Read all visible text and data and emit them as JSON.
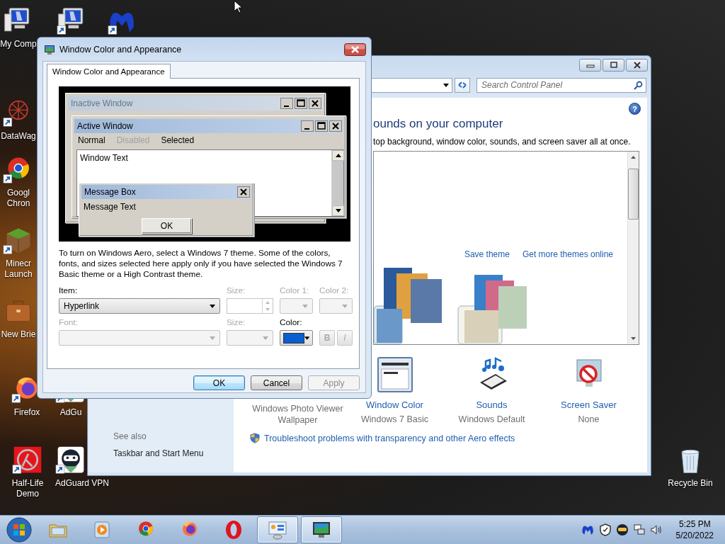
{
  "desktop_icons": [
    {
      "kind": "computer",
      "lines": [
        "My Comp"
      ],
      "shortcut": false
    },
    {
      "kind": "computer",
      "shortcut": true
    },
    {
      "kind": "app-logo",
      "shortcut": true
    },
    {
      "kind": "web",
      "lines": [
        "DataWag"
      ],
      "shortcut": true
    },
    {
      "kind": "chrome",
      "lines": [
        "Googl",
        "Chron"
      ],
      "shortcut": true
    },
    {
      "kind": "block",
      "lines": [
        "Minecr",
        "Launch"
      ],
      "shortcut": true
    },
    {
      "kind": "briefcase",
      "lines": [
        "New Brie"
      ],
      "shortcut": false
    },
    {
      "kind": "firefox",
      "lines": [
        "Firefox"
      ],
      "shortcut": true
    },
    {
      "kind": "ninja",
      "lines": [
        "AdGu"
      ],
      "shortcut": true
    },
    {
      "kind": "lambda",
      "lines": [
        "Half-Life",
        "Demo"
      ],
      "shortcut": true
    },
    {
      "kind": "ninja",
      "lines": [
        "AdGuard VPN"
      ],
      "shortcut": true
    },
    {
      "kind": "recycle",
      "lines": [
        "Recycle Bin"
      ],
      "shortcut": false
    }
  ],
  "control_panel": {
    "search": {
      "placeholder": "Search Control Panel"
    },
    "help_button": "?",
    "heading": "ounds on your computer",
    "subtitle": "top background, window color, sounds, and screen saver all at once.",
    "theme_links": [
      "Save theme",
      "Get more themes online"
    ],
    "themes": [
      {
        "selected": false
      },
      {
        "selected": true
      }
    ],
    "settings": [
      {
        "kind": "background",
        "sublabel": [
          "Windows Photo Viewer",
          "Wallpaper"
        ]
      },
      {
        "kind": "window-color",
        "label": "Window Color",
        "sublabel": [
          "Windows 7 Basic"
        ]
      },
      {
        "kind": "sounds",
        "label": "Sounds",
        "sublabel": [
          "Windows Default"
        ]
      },
      {
        "kind": "screen-saver",
        "label": "Screen Saver",
        "sublabel": [
          "None"
        ]
      }
    ],
    "see_also": {
      "title": "See also",
      "links": [
        "Taskbar and Start Menu"
      ]
    },
    "troubleshoot_link": "Troubleshoot problems with transparency and other Aero effects"
  },
  "dialog": {
    "title": "Window Color and Appearance",
    "tabs": [
      {
        "label": "Window Color and Appearance",
        "selected": true
      }
    ],
    "preview": {
      "inactive_title": "Inactive Window",
      "active_title": "Active Window",
      "menu": [
        {
          "label": "Normal",
          "disabled": false
        },
        {
          "label": "Disabled",
          "disabled": true
        },
        {
          "label": "Selected",
          "disabled": false
        }
      ],
      "window_text": "Window Text",
      "message_box": {
        "title": "Message Box",
        "text": "Message Text",
        "button": "OK"
      }
    },
    "description": "To turn on Windows Aero, select a Windows 7 theme.  Some of the colors, fonts, and sizes selected here apply only if you have selected the Windows 7 Basic theme or a High Contrast theme.",
    "fields": [
      {
        "kind": "dropdown",
        "label": "Item:",
        "value": "Hyperlink",
        "disabled": false
      },
      {
        "kind": "spinner",
        "label": "Size:",
        "disabled": true
      },
      {
        "kind": "dropdown",
        "label": "Color 1:",
        "disabled": true
      },
      {
        "kind": "dropdown",
        "label": "Color 2:",
        "disabled": true
      },
      {
        "kind": "dropdown",
        "label": "Font:",
        "disabled": true
      },
      {
        "kind": "dropdown",
        "label": "Size:",
        "disabled": true
      },
      {
        "kind": "color",
        "label": "Color:",
        "color": "#0a5fd0",
        "disabled": false
      },
      {
        "kind": "style-buttons",
        "buttons": [
          "B",
          "I"
        ],
        "disabled": true
      }
    ],
    "buttons": [
      {
        "label": "OK",
        "default": true,
        "disabled": false
      },
      {
        "label": "Cancel",
        "default": false,
        "disabled": false
      },
      {
        "label": "Apply",
        "default": false,
        "disabled": true
      }
    ]
  },
  "taskbar": {
    "pinned": [
      {
        "kind": "explorer",
        "active": false
      },
      {
        "kind": "media-player",
        "active": false
      },
      {
        "kind": "chrome",
        "active": false
      },
      {
        "kind": "firefox",
        "active": false
      },
      {
        "kind": "opera",
        "active": false
      },
      {
        "kind": "control-panel",
        "active": true
      },
      {
        "kind": "display",
        "active": true
      }
    ],
    "tray": [
      {
        "kind": "app-logo"
      },
      {
        "kind": "shield"
      },
      {
        "kind": "ninja"
      },
      {
        "kind": "network"
      },
      {
        "kind": "volume"
      }
    ],
    "time": "5:25 PM",
    "date": "5/20/2022"
  }
}
